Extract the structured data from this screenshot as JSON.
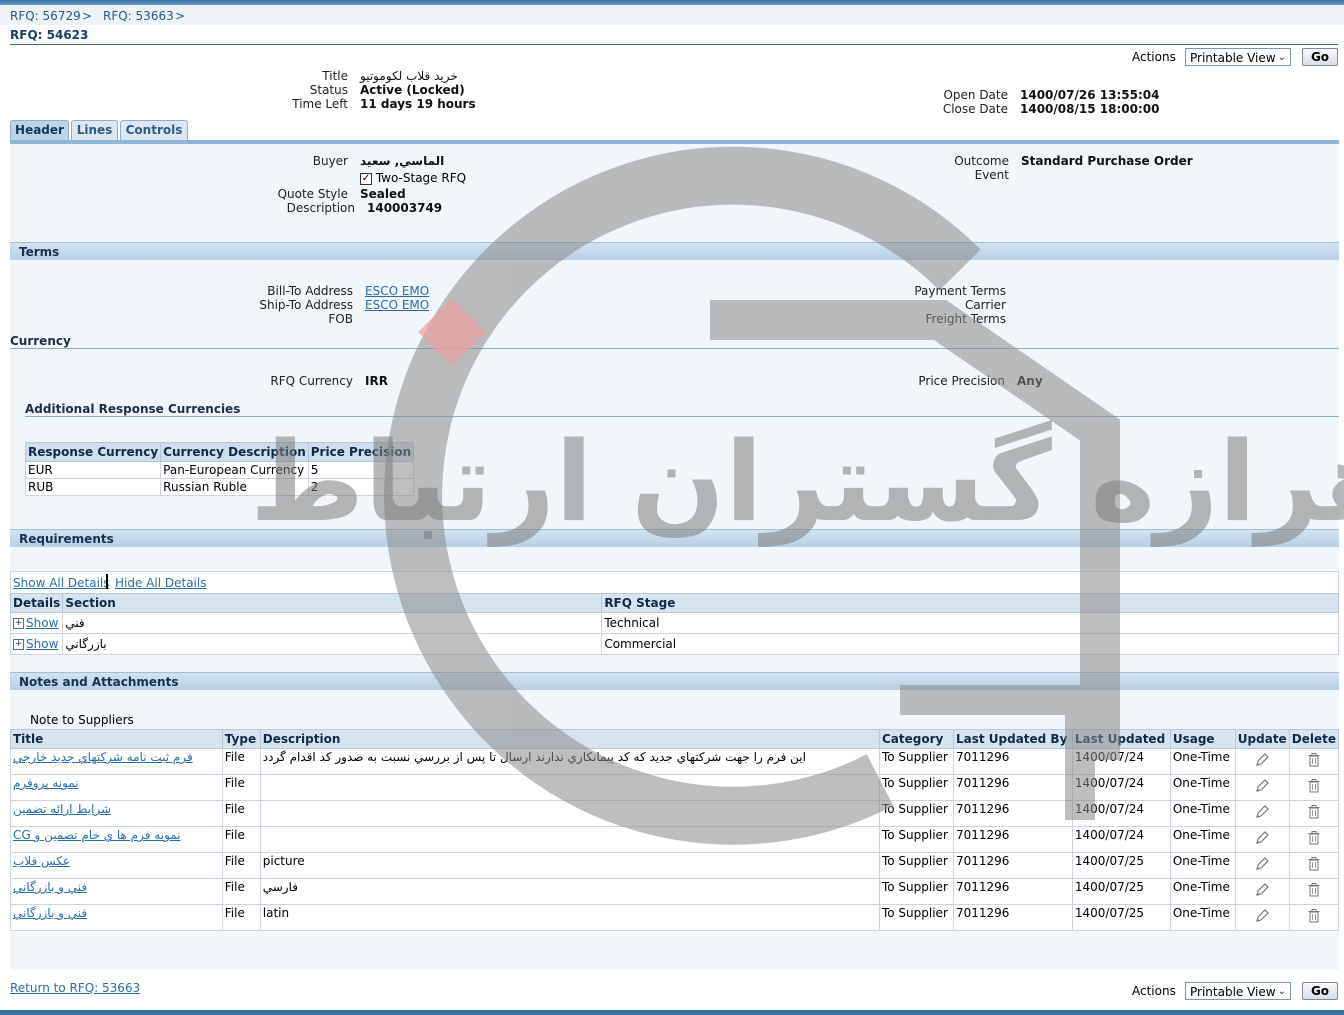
{
  "breadcrumbs": [
    "RFQ: 56729",
    ">",
    "RFQ: 53663",
    ">"
  ],
  "page_title": "RFQ: 54623",
  "actions": {
    "label": "Actions",
    "select_value": "Printable View",
    "go_label": "Go"
  },
  "summary": {
    "title_label": "Title",
    "title_value": "خريد قلاب لكوموتيو",
    "status_label": "Status",
    "status_value": "Active (Locked)",
    "time_left_label": "Time Left",
    "time_left_value": "11 days 19 hours",
    "open_date_label": "Open Date",
    "open_date_value": "1400/07/26 13:55:04",
    "close_date_label": "Close Date",
    "close_date_value": "1400/08/15 18:00:00"
  },
  "tabs": [
    "Header",
    "Lines",
    "Controls"
  ],
  "header": {
    "buyer_label": "Buyer",
    "buyer_value": "الماسي, سعيد",
    "two_stage_label": "Two-Stage RFQ",
    "quote_style_label": "Quote Style",
    "quote_style_value": "Sealed",
    "description_label": "Description",
    "description_value": "140003749",
    "outcome_label": "Outcome",
    "outcome_value": "Standard Purchase Order",
    "event_label": "Event"
  },
  "terms": {
    "heading": "Terms",
    "bill_to_label": "Bill-To Address",
    "bill_to_value": "ESCO EMO",
    "ship_to_label": "Ship-To Address",
    "ship_to_value": "ESCO EMO",
    "fob_label": "FOB",
    "payment_terms_label": "Payment Terms",
    "carrier_label": "Carrier",
    "freight_terms_label": "Freight Terms"
  },
  "currency": {
    "heading": "Currency",
    "rfq_currency_label": "RFQ Currency",
    "rfq_currency_value": "IRR",
    "price_precision_label": "Price Precision",
    "price_precision_value": "Any",
    "additional_heading": "Additional Response Currencies",
    "columns": [
      "Response Currency",
      "Currency Description",
      "Price Precision"
    ],
    "rows": [
      [
        "EUR",
        "Pan-European Currency",
        "5"
      ],
      [
        "RUB",
        "Russian Ruble",
        "2"
      ]
    ]
  },
  "requirements": {
    "heading": "Requirements",
    "show_all": "Show All Details",
    "hide_all": "Hide All Details",
    "columns": [
      "Details",
      "Section",
      "RFQ Stage"
    ],
    "rows": [
      {
        "show": "Show",
        "section": "فني",
        "stage": "Technical"
      },
      {
        "show": "Show",
        "section": "بازرگاني",
        "stage": "Commercial"
      }
    ]
  },
  "notes": {
    "heading": "Notes and Attachments",
    "note_label": "Note to Suppliers",
    "columns": [
      "Title",
      "Type",
      "Description",
      "Category",
      "Last Updated By",
      "Last Updated",
      "Usage",
      "Update",
      "Delete"
    ],
    "rows": [
      {
        "title": "فرم ثبت نامه شركتهاي جديد خارجي",
        "type": "File",
        "description": "اين فرم را جهت شركتهاي جديد كه كد پيمانكاري ندارند ارسال تا پس از بررسي نسبت به صدور كد اقدام گردد",
        "category": "To Supplier",
        "by": "7011296",
        "updated": "1400/07/24",
        "usage": "One-Time"
      },
      {
        "title": "نمونه پروفرم",
        "type": "File",
        "description": "",
        "category": "To Supplier",
        "by": "7011296",
        "updated": "1400/07/24",
        "usage": "One-Time"
      },
      {
        "title": "شرايط ارائه تضمين",
        "type": "File",
        "description": "",
        "category": "To Supplier",
        "by": "7011296",
        "updated": "1400/07/24",
        "usage": "One-Time"
      },
      {
        "title": "CG نمونه فرم ها ي خام تضمين و",
        "type": "File",
        "description": "",
        "category": "To Supplier",
        "by": "7011296",
        "updated": "1400/07/24",
        "usage": "One-Time"
      },
      {
        "title": "عكس قلاب",
        "type": "File",
        "description": "picture",
        "category": "To Supplier",
        "by": "7011296",
        "updated": "1400/07/25",
        "usage": "One-Time"
      },
      {
        "title": "فني و بازرگاني",
        "type": "File",
        "description": "فارسي",
        "category": "To Supplier",
        "by": "7011296",
        "updated": "1400/07/25",
        "usage": "One-Time"
      },
      {
        "title": "فني و بازرگاني",
        "type": "File",
        "description": "latin",
        "category": "To Supplier",
        "by": "7011296",
        "updated": "1400/07/25",
        "usage": "One-Time"
      }
    ]
  },
  "return_link": "Return to RFQ: 53663",
  "watermark_text": "اهرازه گستران ارتباط",
  "colors": {
    "accent": "#3a72a8",
    "panel_bg": "#f1f6fb",
    "link": "#2a6da8"
  }
}
